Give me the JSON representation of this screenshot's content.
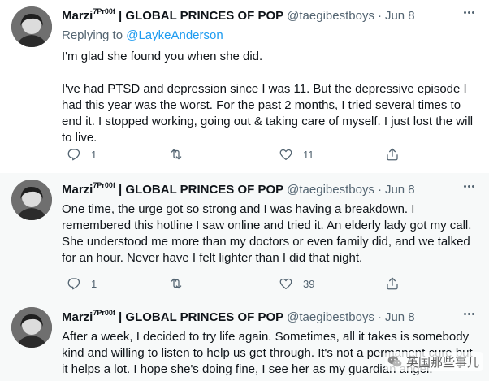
{
  "tweets": [
    {
      "display_name": "Marzi",
      "name_suffix": "7Pr00f",
      "name_rest": " | GLOBAL PRINCES OF POP",
      "handle": "@taegibestboys",
      "separator": "·",
      "date": "Jun 8",
      "replying_label": "Replying to",
      "replying_to": "@LaykeAnderson",
      "body": "I'm glad she found you when she did.\n\nI've had PTSD and depression since I was 11. But the depressive episode I had this year was the worst. For the past 2 months, I tried several times to end it. I stopped working, going out & taking care of myself. I just lost the will to live.",
      "replies": "1",
      "retweets": "",
      "likes": "11"
    },
    {
      "display_name": "Marzi",
      "name_suffix": "7Pr00f",
      "name_rest": " | GLOBAL PRINCES OF POP",
      "handle": "@taegibestboys",
      "separator": "·",
      "date": "Jun 8",
      "body": "One time, the urge got so strong and I was having a breakdown. I remembered this hotline I saw online and tried it. An elderly lady got my call. She understood me more than my doctors or even family did, and we talked for an hour. Never have I felt lighter than I did that night.",
      "replies": "1",
      "retweets": "",
      "likes": "39"
    },
    {
      "display_name": "Marzi",
      "name_suffix": "7Pr00f",
      "name_rest": " | GLOBAL PRINCES OF POP",
      "handle": "@taegibestboys",
      "separator": "·",
      "date": "Jun 8",
      "body": "After a week, I decided to try life again. Sometimes, all it takes is somebody kind and willing to listen to help us get through. It's not a permanent cure but it helps a lot. I hope she's doing fine, I see her as my guardian angel."
    }
  ],
  "watermark": {
    "text": "英国那些事儿",
    "icon": "wechat-logo-icon"
  },
  "colors": {
    "text": "#0f1419",
    "secondary": "#536471",
    "link": "#1d9bf0",
    "highlight_bg": "#f7f9f9"
  }
}
